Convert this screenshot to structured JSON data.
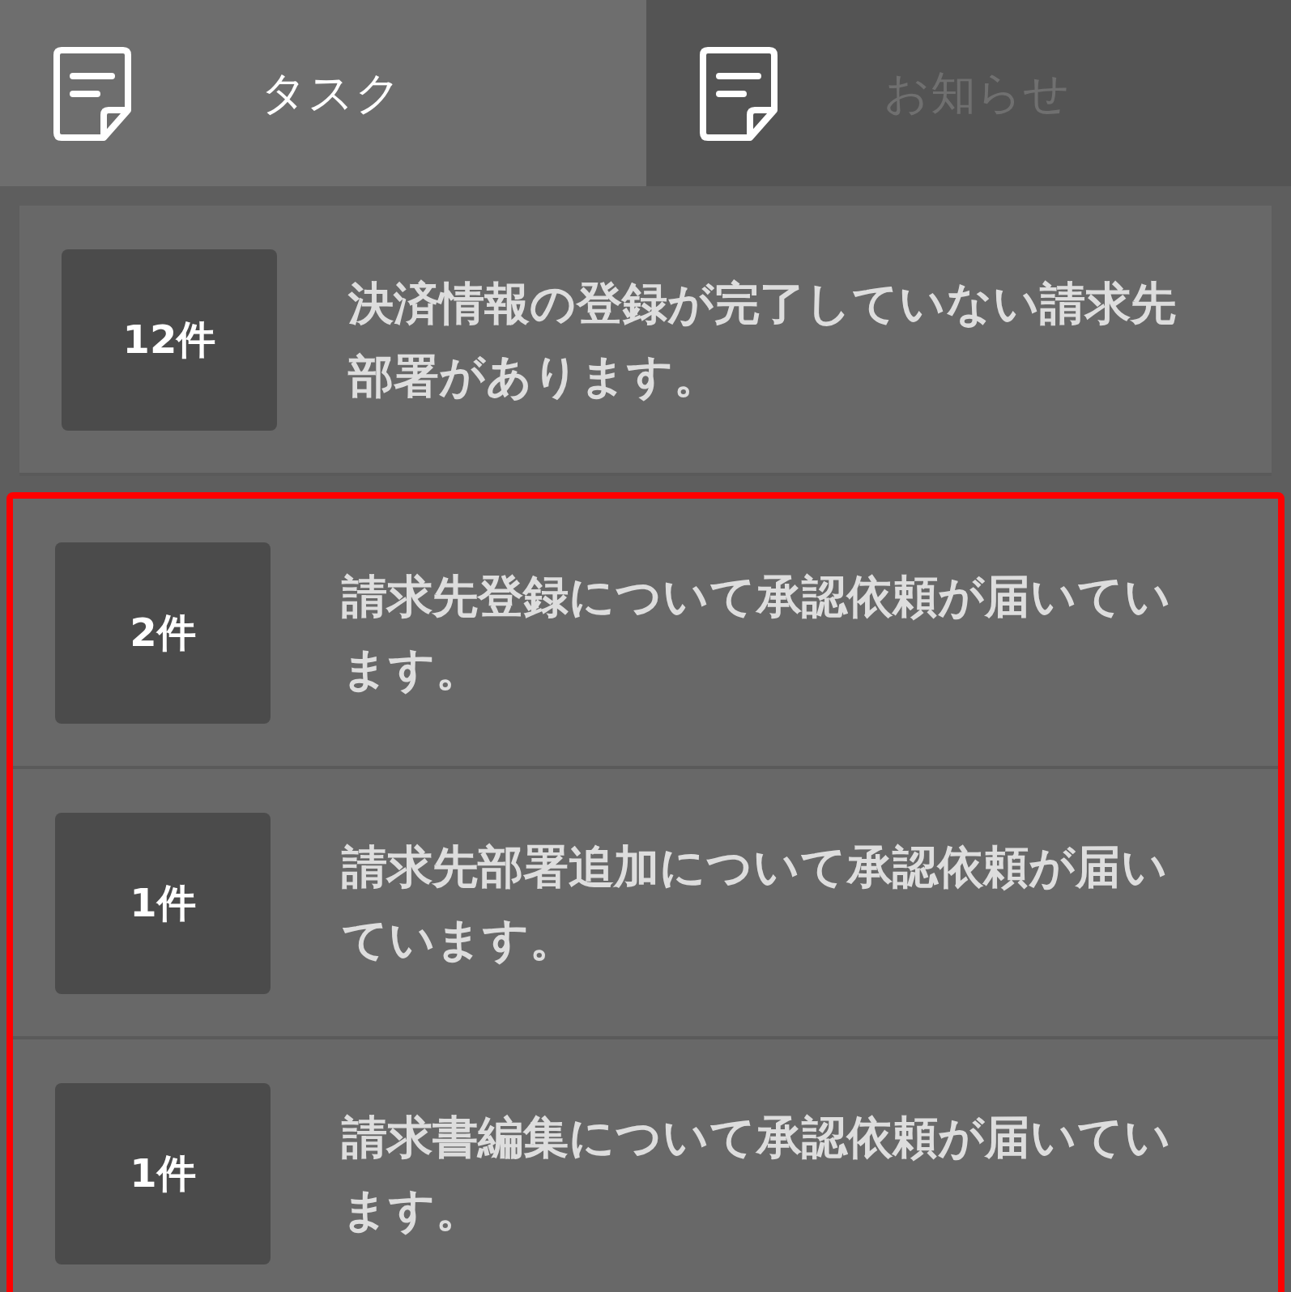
{
  "tabs": [
    {
      "label": "タスク",
      "selected": true
    },
    {
      "label": "お知らせ",
      "selected": false
    }
  ],
  "tasks": [
    {
      "count": "12件",
      "message": "決済情報の登録が完了していない請求先部署があります。",
      "highlighted": false
    },
    {
      "count": "2件",
      "message": "請求先登録について承認依頼が届いています。",
      "highlighted": true
    },
    {
      "count": "1件",
      "message": "請求先部署追加について承認依頼が届いています。",
      "highlighted": true
    },
    {
      "count": "1件",
      "message": "請求書編集について承認依頼が届いています。",
      "highlighted": true
    }
  ]
}
